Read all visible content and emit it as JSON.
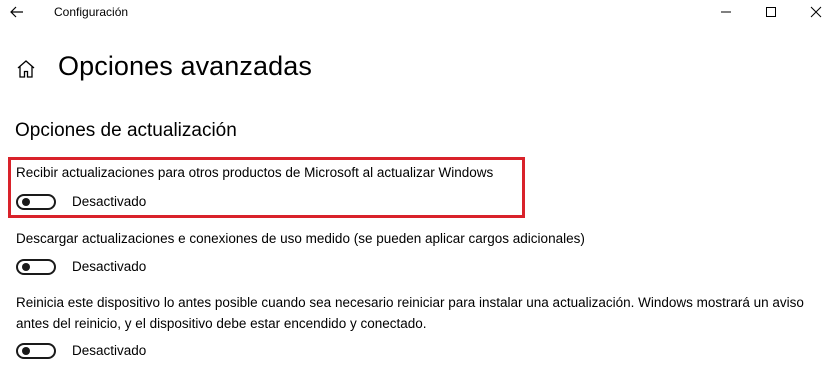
{
  "window": {
    "title": "Configuración"
  },
  "header": {
    "title": "Opciones avanzadas"
  },
  "section": {
    "title": "Opciones de actualización"
  },
  "options": [
    {
      "label": "Recibir actualizaciones para otros productos de Microsoft al actualizar Windows",
      "state": "Desactivado",
      "on": false,
      "highlighted": true
    },
    {
      "label": "Descargar actualizaciones e conexiones de uso medido (se pueden aplicar cargos adicionales)",
      "state": "Desactivado",
      "on": false,
      "highlighted": false
    },
    {
      "label": "Reinicia este dispositivo lo antes posible cuando sea necesario reiniciar para instalar una actualización. Windows mostrará un aviso antes del reinicio, y el dispositivo debe estar encendido y conectado.",
      "state": "Desactivado",
      "on": false,
      "highlighted": false
    }
  ],
  "colors": {
    "highlight": "#d9222a",
    "toggle_off": "#1a1a1a"
  },
  "icons": {
    "back": "back-arrow-icon",
    "home": "home-icon",
    "minimize": "minimize-icon",
    "maximize": "maximize-icon",
    "close": "close-icon"
  }
}
